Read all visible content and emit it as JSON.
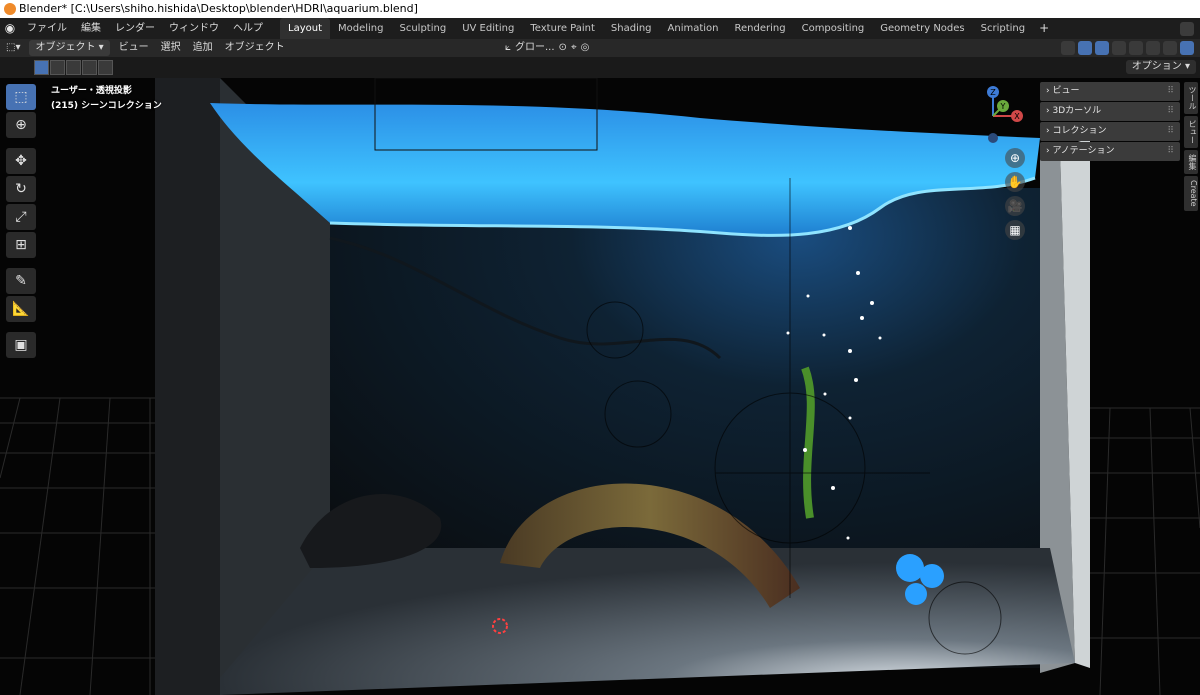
{
  "title": "Blender* [C:\\Users\\shiho.hishida\\Desktop\\blender\\HDRI\\aquarium.blend]",
  "menu": [
    "ファイル",
    "編集",
    "レンダー",
    "ウィンドウ",
    "ヘルプ"
  ],
  "workspaces": [
    "Layout",
    "Modeling",
    "Sculpting",
    "UV Editing",
    "Texture Paint",
    "Shading",
    "Animation",
    "Rendering",
    "Compositing",
    "Geometry Nodes",
    "Scripting"
  ],
  "active_workspace": "Layout",
  "add_tab_label": "+",
  "header": {
    "mode": "オブジェクト",
    "menus": [
      "ビュー",
      "選択",
      "追加",
      "オブジェクト"
    ],
    "orientation": "グロー..."
  },
  "options_label": "オプション",
  "viewport": {
    "view_name": "ユーザー・透視投影",
    "collection": "(215) シーンコレクション"
  },
  "npanel": {
    "sections": [
      "ビュー",
      "3Dカーソル",
      "コレクション",
      "アノテーション"
    ],
    "tabs": [
      "ツール",
      "ビュー",
      "編集",
      "Create"
    ]
  },
  "gizmo": {
    "z": "Z",
    "y": "Y",
    "x": "X"
  },
  "colors": {
    "accent": "#4772b3",
    "water": "#2ea8ff"
  }
}
